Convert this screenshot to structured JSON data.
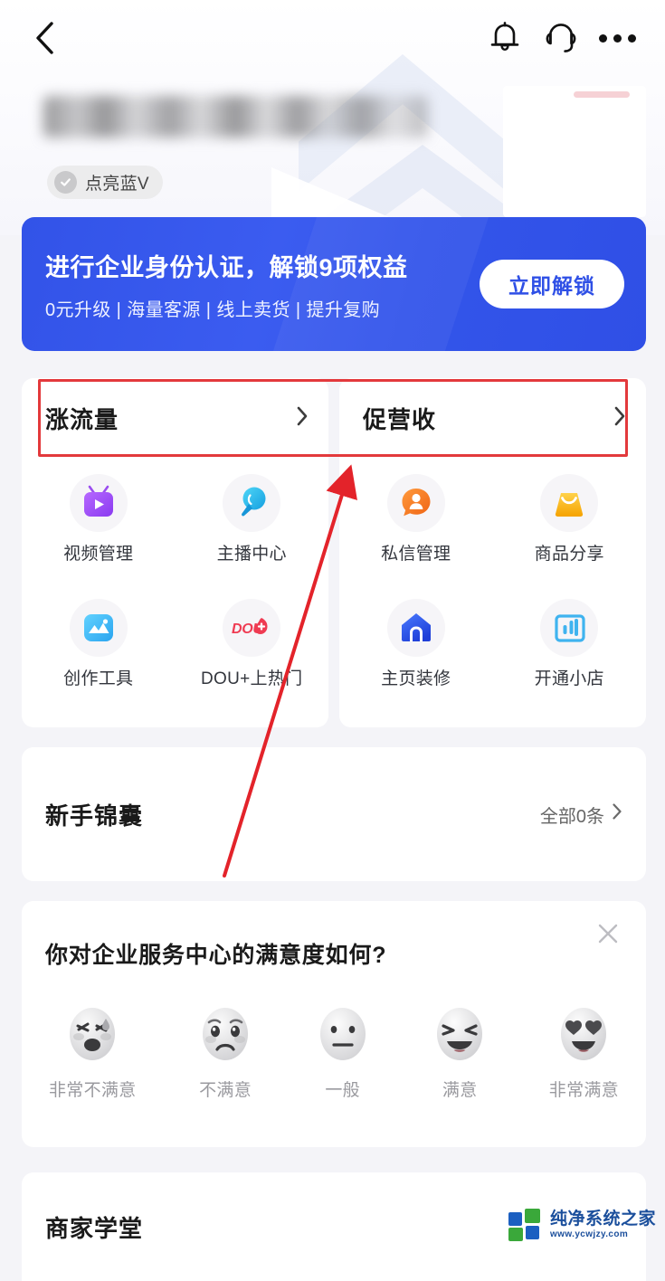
{
  "topbar": {
    "back_icon": "chevron-left-icon",
    "notification_icon": "bell-icon",
    "support_icon": "headset-icon",
    "more_icon": "more-dots-icon"
  },
  "profile": {
    "name_masked": "",
    "badge": {
      "label": "点亮蓝V",
      "icon": "check-circle-icon"
    }
  },
  "promo": {
    "title": "进行企业身份认证，解锁9项权益",
    "subtitle": "0元升级 | 海量客源 | 线上卖货 | 提升复购",
    "button_label": "立即解锁",
    "bg_color": "#3354ea",
    "button_text_color": "#2f50e6"
  },
  "panels": [
    {
      "title": "涨流量",
      "items": [
        {
          "label": "视频管理",
          "icon": "tv-play-icon",
          "color": "#9b4df0"
        },
        {
          "label": "主播中心",
          "icon": "mic-bubble-icon",
          "color": "#23b7e8"
        },
        {
          "label": "创作工具",
          "icon": "image-mountain-icon",
          "color": "#3fb8f5"
        },
        {
          "label": "DOU+上热门",
          "icon": "dou-plus-icon",
          "color": "#ef4b5e"
        }
      ]
    },
    {
      "title": "促营收",
      "items": [
        {
          "label": "私信管理",
          "icon": "person-bubble-icon",
          "color": "#f37022"
        },
        {
          "label": "商品分享",
          "icon": "shopping-bag-icon",
          "color": "#fdb913"
        },
        {
          "label": "主页装修",
          "icon": "home-icon",
          "color": "#2f57e8"
        },
        {
          "label": "开通小店",
          "icon": "store-chart-icon",
          "color": "#38b6f0"
        }
      ]
    }
  ],
  "novice": {
    "title": "新手锦囊",
    "more_label": "全部0条",
    "more_icon": "chevron-right-icon"
  },
  "survey": {
    "question": "你对企业服务中心的满意度如何?",
    "close_icon": "close-icon",
    "options": [
      {
        "label": "非常不满意",
        "face": "angry-sweat-face"
      },
      {
        "label": "不满意",
        "face": "sad-face"
      },
      {
        "label": "一般",
        "face": "neutral-face"
      },
      {
        "label": "满意",
        "face": "happy-face"
      },
      {
        "label": "非常满意",
        "face": "heart-eyes-face"
      }
    ]
  },
  "school": {
    "title": "商家学堂"
  },
  "annotations": {
    "highlight_color": "#e3393c",
    "arrow_color": "#e3232a"
  },
  "watermark": {
    "name": "纯净系统之家",
    "url": "www.ycwjzy.com"
  }
}
